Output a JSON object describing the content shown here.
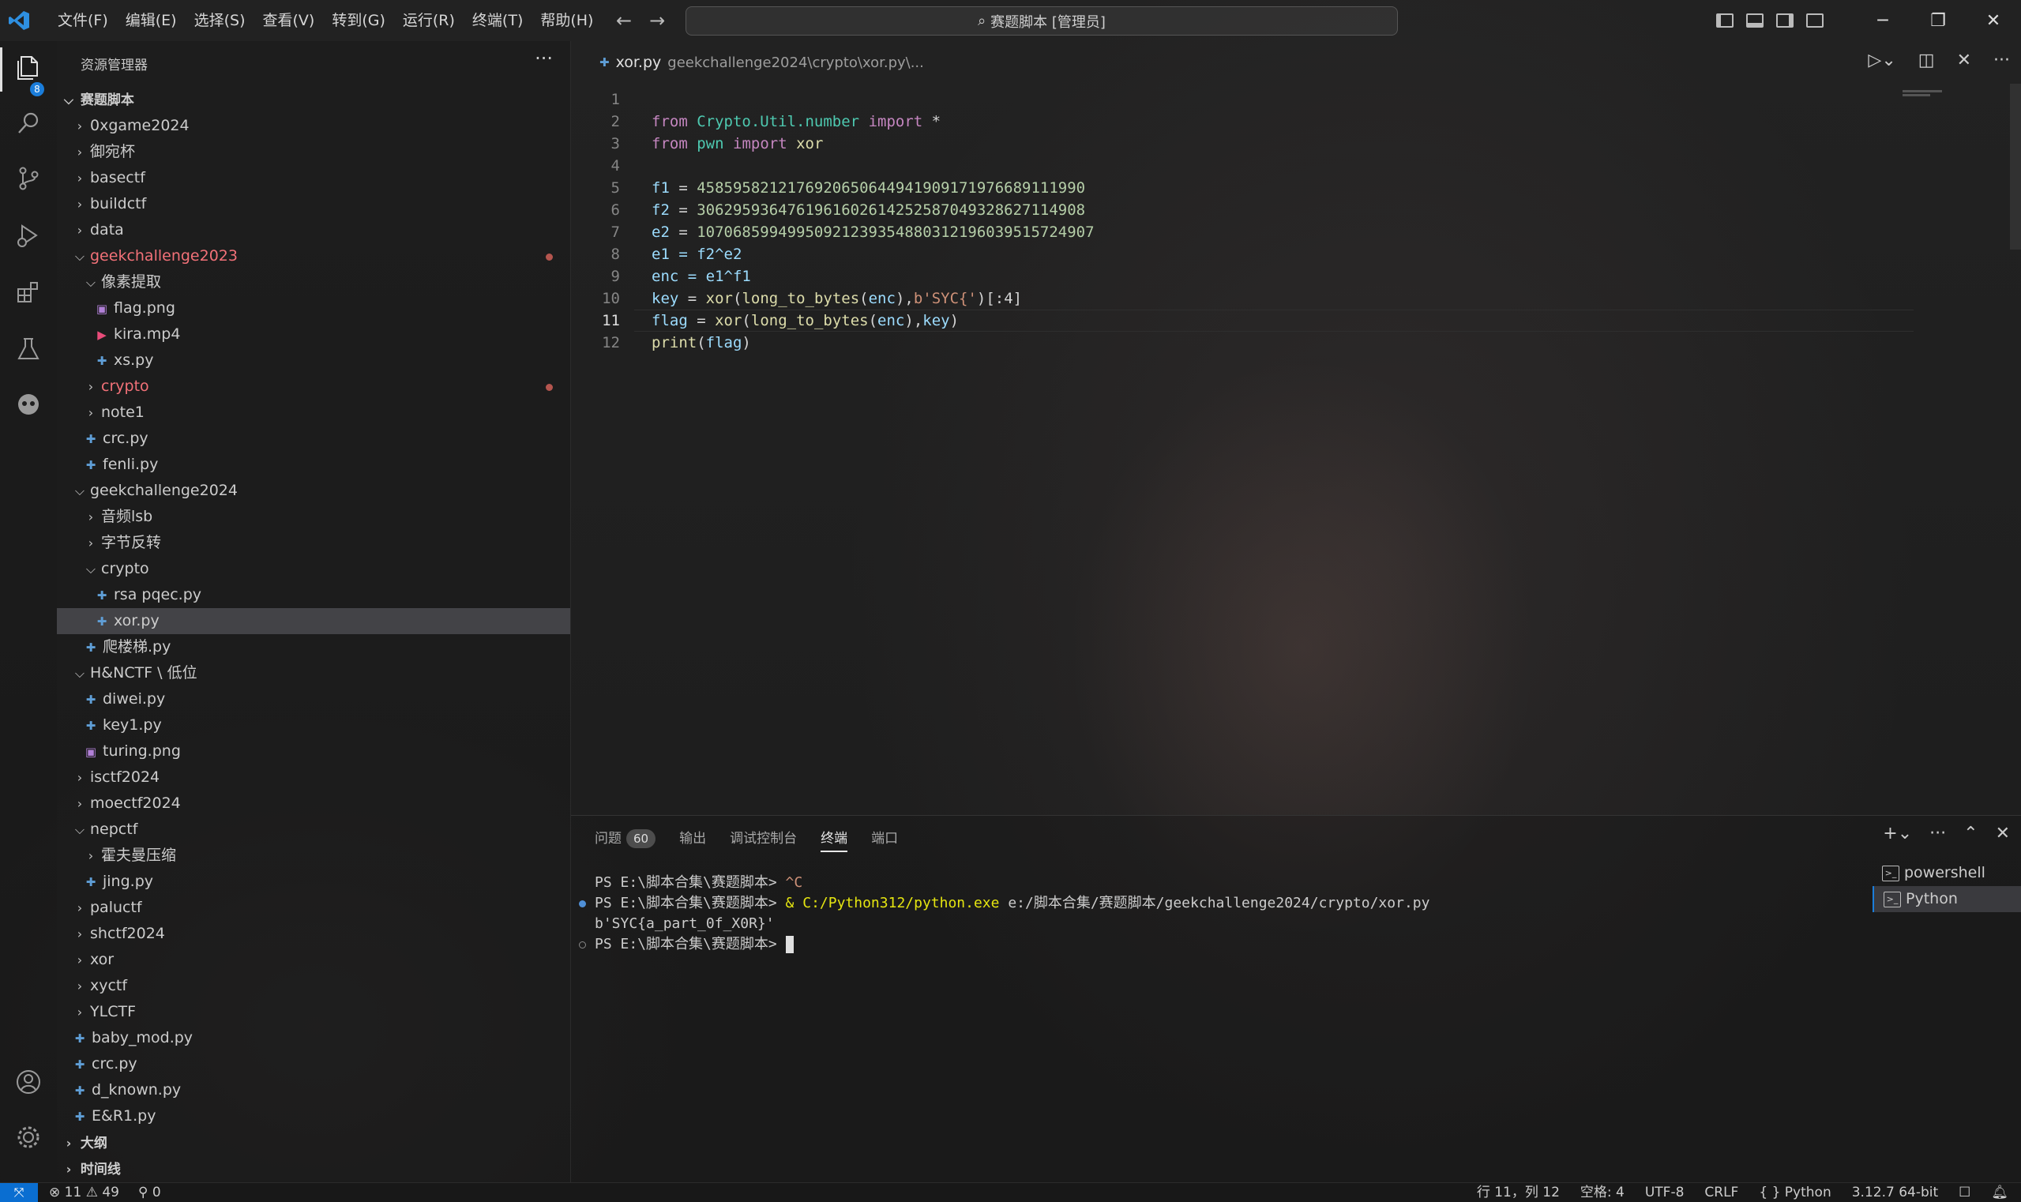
{
  "window": {
    "title": "赛题脚本 [管理员]"
  },
  "menu": [
    "文件(F)",
    "编辑(E)",
    "选择(S)",
    "查看(V)",
    "转到(G)",
    "运行(R)",
    "终端(T)",
    "帮助(H)"
  ],
  "activity": {
    "explorer_badge": "8"
  },
  "explorer": {
    "header": "资源管理器",
    "root": "赛题脚本",
    "items": [
      {
        "label": "0xgame2024",
        "depth": 1,
        "type": "folder",
        "open": false
      },
      {
        "label": "御宛杯",
        "depth": 1,
        "type": "folder",
        "open": false
      },
      {
        "label": "basectf",
        "depth": 1,
        "type": "folder",
        "open": false
      },
      {
        "label": "buildctf",
        "depth": 1,
        "type": "folder",
        "open": false
      },
      {
        "label": "data",
        "depth": 1,
        "type": "folder",
        "open": false
      },
      {
        "label": "geekchallenge2023",
        "depth": 1,
        "type": "folder",
        "open": true,
        "modified": true
      },
      {
        "label": "像素提取",
        "depth": 2,
        "type": "folder",
        "open": true
      },
      {
        "label": "flag.png",
        "depth": 3,
        "type": "image"
      },
      {
        "label": "kira.mp4",
        "depth": 3,
        "type": "video"
      },
      {
        "label": "xs.py",
        "depth": 3,
        "type": "py"
      },
      {
        "label": "crypto",
        "depth": 2,
        "type": "folder",
        "open": false,
        "modified": true
      },
      {
        "label": "note1",
        "depth": 2,
        "type": "folder",
        "open": false
      },
      {
        "label": "crc.py",
        "depth": 2,
        "type": "py"
      },
      {
        "label": "fenli.py",
        "depth": 2,
        "type": "py"
      },
      {
        "label": "geekchallenge2024",
        "depth": 1,
        "type": "folder",
        "open": true
      },
      {
        "label": "音频lsb",
        "depth": 2,
        "type": "folder",
        "open": false
      },
      {
        "label": "字节反转",
        "depth": 2,
        "type": "folder",
        "open": false
      },
      {
        "label": "crypto",
        "depth": 2,
        "type": "folder",
        "open": true
      },
      {
        "label": "rsa pqec.py",
        "depth": 3,
        "type": "py"
      },
      {
        "label": "xor.py",
        "depth": 3,
        "type": "py",
        "selected": true
      },
      {
        "label": "爬楼梯.py",
        "depth": 2,
        "type": "py"
      },
      {
        "label": "H&NCTF \\ 低位",
        "depth": 1,
        "type": "folder",
        "open": true
      },
      {
        "label": "diwei.py",
        "depth": 2,
        "type": "py"
      },
      {
        "label": "key1.py",
        "depth": 2,
        "type": "py"
      },
      {
        "label": "turing.png",
        "depth": 2,
        "type": "image"
      },
      {
        "label": "isctf2024",
        "depth": 1,
        "type": "folder",
        "open": false
      },
      {
        "label": "moectf2024",
        "depth": 1,
        "type": "folder",
        "open": false
      },
      {
        "label": "nepctf",
        "depth": 1,
        "type": "folder",
        "open": true
      },
      {
        "label": "霍夫曼压缩",
        "depth": 2,
        "type": "folder",
        "open": false
      },
      {
        "label": "jing.py",
        "depth": 2,
        "type": "py"
      },
      {
        "label": "paluctf",
        "depth": 1,
        "type": "folder",
        "open": false
      },
      {
        "label": "shctf2024",
        "depth": 1,
        "type": "folder",
        "open": false
      },
      {
        "label": "xor",
        "depth": 1,
        "type": "folder",
        "open": false
      },
      {
        "label": "xyctf",
        "depth": 1,
        "type": "folder",
        "open": false
      },
      {
        "label": "YLCTF",
        "depth": 1,
        "type": "folder",
        "open": false
      },
      {
        "label": "baby_mod.py",
        "depth": 1,
        "type": "py"
      },
      {
        "label": "crc.py",
        "depth": 1,
        "type": "py"
      },
      {
        "label": "d_known.py",
        "depth": 1,
        "type": "py"
      },
      {
        "label": "E&R1.py",
        "depth": 1,
        "type": "py"
      }
    ],
    "outline": "大纲",
    "timeline": "时间线"
  },
  "editor": {
    "tab_file": "xor.py",
    "tab_path": "geekchallenge2024\\crypto\\xor.py\\...",
    "current_line": 11,
    "lines": [
      "1",
      "2",
      "3",
      "4",
      "5",
      "6",
      "7",
      "8",
      "9",
      "10",
      "11",
      "12"
    ],
    "code": {
      "l1_a": "from",
      "l1_b": "Crypto.Util.number",
      "l1_c": "import",
      "l1_d": " *",
      "l2_a": "from",
      "l2_b": "pwn",
      "l2_c": "import",
      "l2_d": "xor",
      "l4_var": "f1",
      "l4_num": "4585958212176920650644941909171976689111990",
      "l5_var": "f2",
      "l5_num": "3062959364761961602614252587049328627114908",
      "l6_var": "e2",
      "l6_num": "1070685994995092123935488031219603951572490​7",
      "l7": "e1 = f2^e2",
      "l8": "enc = e1^f1",
      "l9_a": "key",
      "l9_b": "xor",
      "l9_c": "long_to_bytes",
      "l9_d": "enc",
      "l9_e": "b'SYC{'",
      "l9_f": "[:4]",
      "l10_a": "flag",
      "l10_b": "xor",
      "l10_c": "long_to_bytes",
      "l10_d": "enc",
      "l10_e": "key",
      "l11_a": "print",
      "l11_b": "flag"
    }
  },
  "panel": {
    "tabs": [
      "问题",
      "输出",
      "调试控制台",
      "终端",
      "端口"
    ],
    "problems_count": "60",
    "active_tab": "终端",
    "terminal": {
      "line1_prompt": "PS E:\\脚本合集\\赛题脚本> ",
      "line1_cmd": "^C",
      "line2_prompt": "PS E:\\脚本合集\\赛题脚本> ",
      "line2_amp": "& ",
      "line2_exe": "C:/Python312/python.exe",
      "line2_arg": " e:/脚本合集/赛题脚本/geekchallenge2024/crypto/xor.py",
      "line3_output": "b'SYC{a_part_0f_X0R}'",
      "line4_prompt": "PS E:\\脚本合集\\赛题脚本> "
    },
    "terminal_list": [
      "powershell",
      "Python"
    ]
  },
  "status": {
    "errors": "11",
    "warnings": "49",
    "ports": "0",
    "cursor_pos": "行 11，列 12",
    "spaces": "空格: 4",
    "encoding": "UTF-8",
    "eol": "CRLF",
    "language": "Python",
    "interpreter": "3.12.7 64-bit"
  },
  "colors": {
    "accent": "#1a7ddb",
    "modified_dot": "#b4554e",
    "modified_text": "#f27178"
  }
}
